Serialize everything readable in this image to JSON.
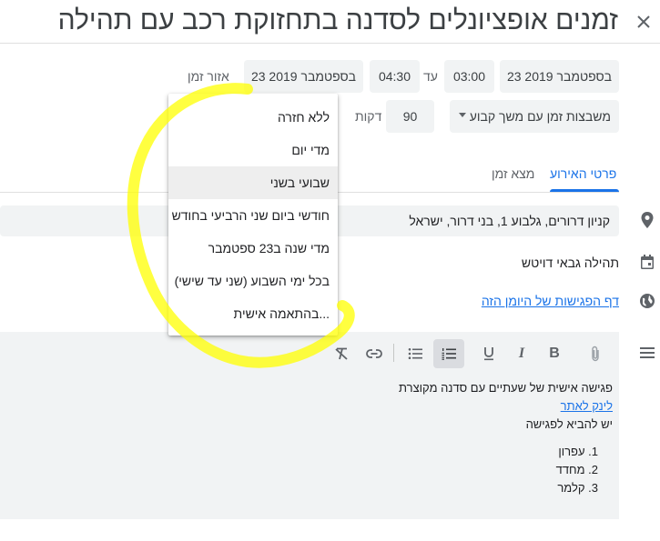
{
  "title": "זמנים אופציונלים לסדנה בתחזוקת רכב עם תהילה",
  "time_row": {
    "start_date": "23 בספטמבר 2019",
    "start_time": "03:00",
    "until_label": "עד",
    "end_time": "04:30",
    "end_date": "23 בספטמבר 2019",
    "timezone_label": "אזור זמן"
  },
  "slot_row": {
    "slot_select": "משבצות זמן עם משך קבוע",
    "duration_value": "90",
    "duration_unit": "דקות"
  },
  "recurrence_menu": {
    "items": [
      "ללא חזרה",
      "מדי יום",
      "שבועי בשני",
      "חודשי ביום שני הרביעי בחודש",
      "מדי שנה ב23 ספטמבר",
      "בכל ימי השבוע (שני עד שישי)",
      "בהתאמה אישית..."
    ],
    "selected_index": 2
  },
  "tabs": [
    {
      "label": "פרטי האירוע",
      "active": true
    },
    {
      "label": "מצא זמן",
      "active": false
    }
  ],
  "details": {
    "location": "קניון דרורים, גלבוע 1, בני דרור, ישראל",
    "calendar_owner": "תהילה גבאי דויטש",
    "booking_page_link": "דף הפגישות של היומן הזה"
  },
  "description": {
    "line1": "פגישה אישית של שעתיים עם סדנה מקוצרת",
    "link": "לינק לאתר",
    "line3": "יש להביא לפגישה",
    "list": [
      "עפרון",
      "מחדד",
      "קלמר"
    ]
  },
  "colors": {
    "accent": "#1a73e8",
    "field_bg": "#f1f3f4",
    "annotation": "#ffff00"
  }
}
